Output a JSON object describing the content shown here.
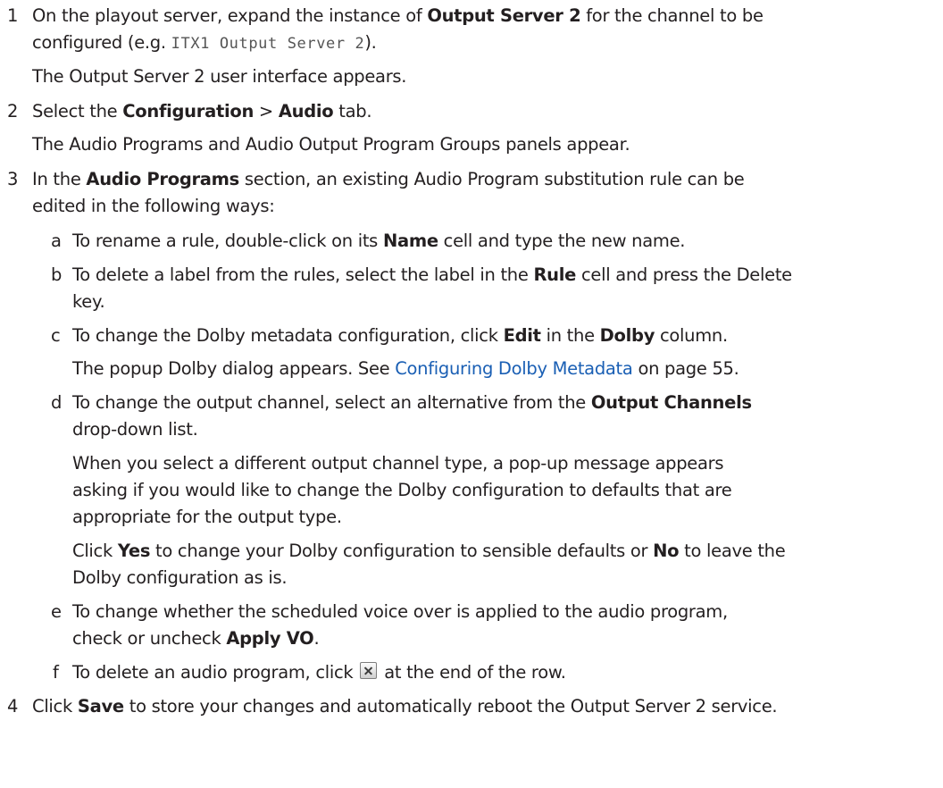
{
  "steps": {
    "s1": {
      "num": "1",
      "a": "On the playout server, expand the instance of ",
      "b": "Output Server 2",
      "c": " for the channel to be",
      "d": "configured (e.g. ",
      "code": "ITX1 Output Server 2",
      "e": ").",
      "result": "The Output Server 2 user interface appears."
    },
    "s2": {
      "num": "2",
      "a": "Select the ",
      "b": "Configuration",
      "c": " > ",
      "d": "Audio",
      "e": " tab.",
      "result": "The Audio Programs and Audio Output Program Groups panels appear."
    },
    "s3": {
      "num": "3",
      "a": "In the ",
      "b": "Audio Programs",
      "c": " section, an existing Audio Program substitution rule can be",
      "d": "edited in the following ways:"
    },
    "s4": {
      "num": "4",
      "a": "Click ",
      "b": "Save",
      "c": " to store your changes and automatically reboot the Output Server 2 service."
    }
  },
  "substeps": {
    "a": {
      "letter": "a",
      "t1": "To rename a rule, double-click on its ",
      "b1": "Name",
      "t2": " cell and type the new name."
    },
    "b": {
      "letter": "b",
      "t1": "To delete a label from the rules, select the label in the ",
      "b1": "Rule",
      "t2": " cell and press the Delete",
      "t3": "key."
    },
    "c": {
      "letter": "c",
      "t1": "To change the Dolby metadata configuration, click ",
      "b1": "Edit",
      "t2": " in the ",
      "b2": "Dolby",
      "t3": " column.",
      "r1": "The popup Dolby dialog appears. See ",
      "link": "Configuring Dolby Metadata",
      "r2": " on page 55."
    },
    "d": {
      "letter": "d",
      "t1": "To change the output channel, select an alternative from the ",
      "b1": "Output Channels",
      "t2": "drop-down list.",
      "p1": "When you select a different output channel type, a pop-up message appears",
      "p2": "asking if you would like to change the Dolby configuration to defaults that are",
      "p3": "appropriate for the output type.",
      "c1": "Click ",
      "yes": "Yes",
      "c2": " to change your Dolby configuration to sensible defaults or ",
      "no": "No",
      "c3": " to leave the",
      "c4": "Dolby configuration as is."
    },
    "e": {
      "letter": "e",
      "t1": "To change whether the scheduled voice over is applied to the audio program,",
      "t2": "check or uncheck ",
      "b1": "Apply VO",
      "t3": "."
    },
    "f": {
      "letter": "f",
      "t1": "To delete an audio program, click ",
      "icon": "close-x-icon",
      "t2": " at the end of the row."
    }
  }
}
